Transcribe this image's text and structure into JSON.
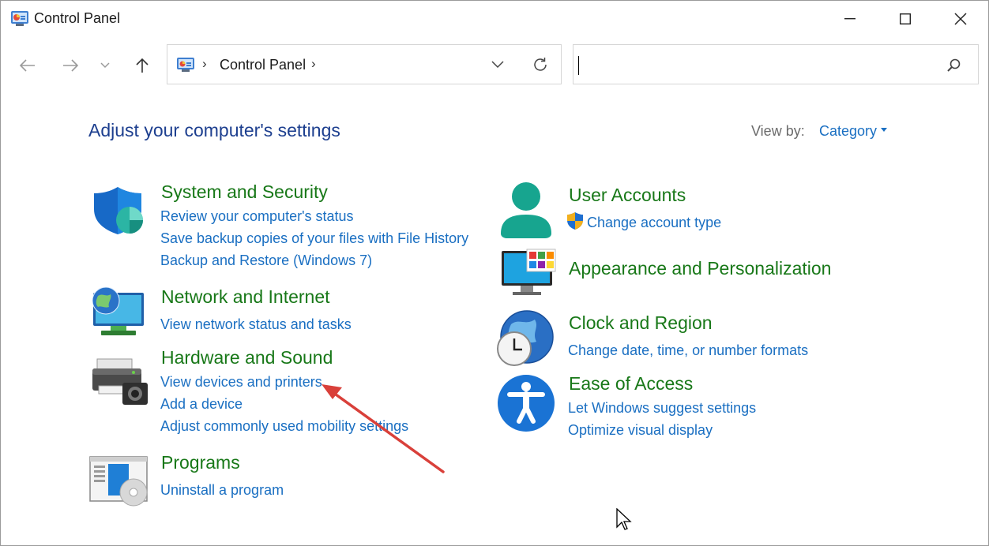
{
  "window": {
    "title": "Control Panel",
    "controls": {
      "minimize": "minimize",
      "maximize": "maximize",
      "close": "close"
    }
  },
  "nav": {
    "back": "back-arrow-icon",
    "forward": "forward-arrow-icon",
    "recent": "chevron-down-icon",
    "up": "up-arrow-icon"
  },
  "address": {
    "crumb": "Control Panel",
    "separator": "›"
  },
  "search": {
    "value": "",
    "placeholder": ""
  },
  "content": {
    "heading": "Adjust your computer's settings",
    "view_by_label": "View by:",
    "view_by_value": "Category",
    "categories": [
      {
        "title": "System and Security",
        "icon": "shield-icon",
        "links": [
          "Review your computer's status",
          "Save backup copies of your files with File History",
          "Backup and Restore (Windows 7)"
        ]
      },
      {
        "title": "Network and Internet",
        "icon": "network-globe-icon",
        "links": [
          "View network status and tasks"
        ]
      },
      {
        "title": "Hardware and Sound",
        "icon": "printer-icon",
        "links": [
          "View devices and printers",
          "Add a device",
          "Adjust commonly used mobility settings"
        ]
      },
      {
        "title": "Programs",
        "icon": "programs-disc-icon",
        "links": [
          "Uninstall a program"
        ]
      },
      {
        "title": "User Accounts",
        "icon": "user-icon",
        "links": [
          "Change account type"
        ]
      },
      {
        "title": "Appearance and Personalization",
        "icon": "monitor-icon",
        "links": []
      },
      {
        "title": "Clock and Region",
        "icon": "clock-globe-icon",
        "links": [
          "Change date, time, or number formats"
        ]
      },
      {
        "title": "Ease of Access",
        "icon": "accessibility-icon",
        "links": [
          "Let Windows suggest settings",
          "Optimize visual display"
        ]
      }
    ]
  },
  "colors": {
    "heading": "#1d3f8f",
    "category_title": "#187818",
    "link": "#1a6fc2",
    "annotation_arrow": "#d9403a"
  }
}
